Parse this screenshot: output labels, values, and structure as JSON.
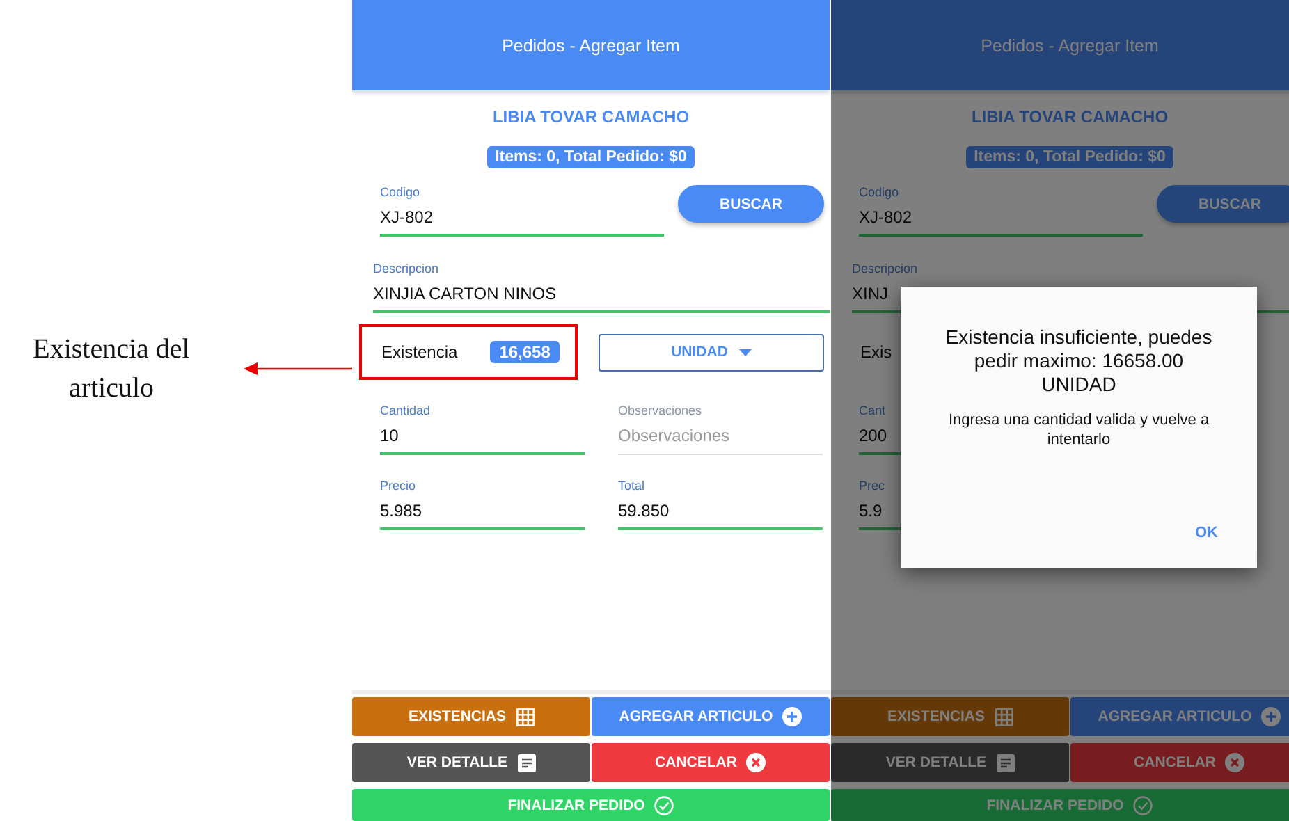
{
  "annotation": {
    "text": "Existencia del articulo"
  },
  "screens": [
    {
      "title": "Pedidos - Agregar Item",
      "customer": "LIBIA TOVAR CAMACHO",
      "summary": "Items: 0, Total Pedido: $0",
      "highlighted": true,
      "dimmed": false,
      "codigo": {
        "label": "Codigo",
        "value": "XJ-802"
      },
      "search_button": "BUSCAR",
      "descripcion": {
        "label": "Descripcion",
        "value": "XINJIA CARTON NINOS"
      },
      "existencia": {
        "label": "Existencia",
        "value": "16,658"
      },
      "unit": "UNIDAD",
      "cantidad": {
        "label": "Cantidad",
        "value": "10"
      },
      "observaciones": {
        "label": "Observaciones",
        "placeholder": "Observaciones"
      },
      "precio": {
        "label": "Precio",
        "value": "5.985"
      },
      "total": {
        "label": "Total",
        "value": "59.850"
      },
      "buttons": [
        {
          "label": "EXISTENCIAS",
          "kind": "stock"
        },
        {
          "label": "AGREGAR ARTICULO",
          "kind": "add"
        },
        {
          "label": "VER DETALLE",
          "kind": "detail"
        },
        {
          "label": "CANCELAR",
          "kind": "cancel"
        }
      ],
      "finish": "FINALIZAR PEDIDO"
    },
    {
      "title": "Pedidos - Agregar Item",
      "customer": "LIBIA TOVAR CAMACHO",
      "summary": "Items: 0, Total Pedido: $0",
      "highlighted": false,
      "dimmed": true,
      "codigo": {
        "label": "Codigo",
        "value": "XJ-802"
      },
      "search_button": "BUSCAR",
      "descripcion": {
        "label": "Descripcion",
        "value": "XINJ"
      },
      "existencia": {
        "label": "Exis"
      },
      "cantidad": {
        "label": "Cant",
        "value": "200"
      },
      "precio": {
        "label": "Prec",
        "value": "5.9"
      },
      "buttons": [
        {
          "label": "EXISTENCIAS",
          "kind": "stock"
        },
        {
          "label": "AGREGAR ARTICULO",
          "kind": "add"
        },
        {
          "label": "VER DETALLE",
          "kind": "detail"
        },
        {
          "label": "CANCELAR",
          "kind": "cancel"
        }
      ],
      "finish": "FINALIZAR PEDIDO",
      "dialog": {
        "title": "Existencia insuficiente, puedes pedir maximo: 16658.00 UNIDAD",
        "message": "Ingresa una cantidad valida y vuelve a intentarlo",
        "ok": "OK"
      }
    }
  ]
}
